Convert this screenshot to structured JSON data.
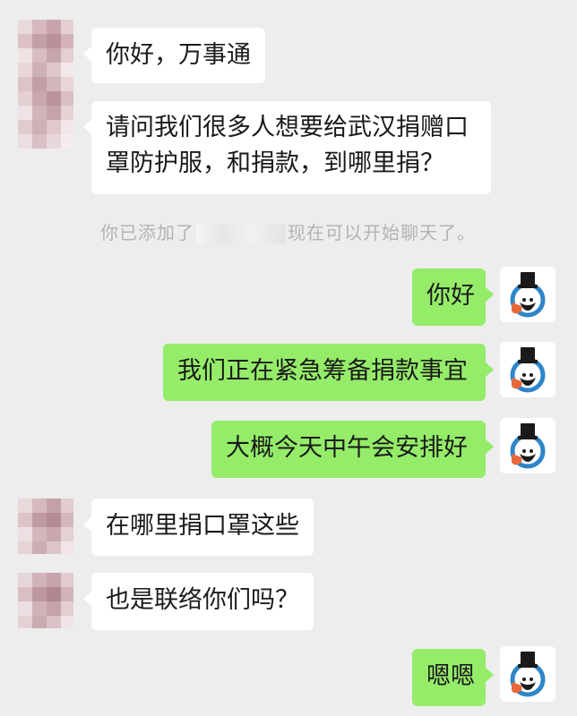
{
  "messages": [
    {
      "side": "left",
      "text": "你好，万事通"
    },
    {
      "side": "left",
      "text": "请问我们很多人想要给武汉捐赠口罩防护服，和捐款，到哪里捐？"
    },
    {
      "side": "system",
      "prefix": "你已添加了",
      "suffix": "现在可以开始聊天了。"
    },
    {
      "side": "right",
      "text": "你好"
    },
    {
      "side": "right",
      "text": "我们正在紧急筹备捐款事宜"
    },
    {
      "side": "right",
      "text": "大概今天中午会安排好"
    },
    {
      "side": "left",
      "text": "在哪里捐口罩这些"
    },
    {
      "side": "left",
      "text": "也是联络你们吗？"
    },
    {
      "side": "right",
      "text": "嗯嗯"
    }
  ],
  "colors": {
    "background": "#ededed",
    "left_bubble": "#ffffff",
    "right_bubble": "#95ec69",
    "system_text": "#b3b3b3"
  },
  "icons": {
    "sender_avatar": "pixelated-avatar",
    "self_avatar": "top-hat-location-logo"
  }
}
